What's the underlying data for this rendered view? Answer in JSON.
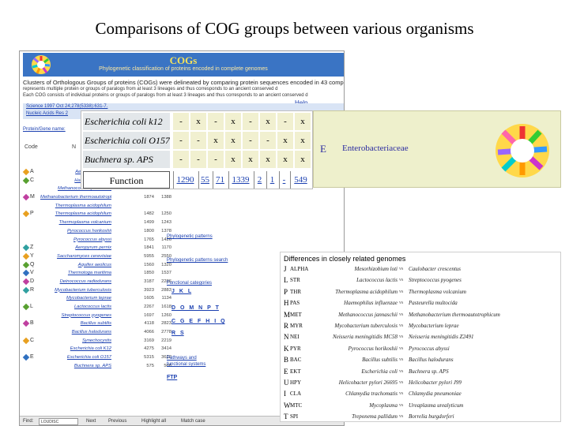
{
  "slide": {
    "title": "Comparisons of COG groups between various organisms"
  },
  "cog_page": {
    "banner_title": "COGs",
    "banner_subtitle": "Phylogenetic classification of proteins encoded in complete genomes",
    "intro_line1": "Clusters of Orthologous Groups of proteins (COGs) were delineated by comparing protein sequences encoded in 43 complete genom",
    "intro_line2": "represents multiple protein or groups of paralogs from at least 3 lineages and thus corresponds to an ancient conserved d",
    "intro_line3": "Each COG consists of individual proteins or groups of paralogs from at least 3 lineages and thus corresponds to an ancient conserved d",
    "help": "Help",
    "ref1": "Science 1997 Oct 24;278(5338):631-7.",
    "ref2": "Nucleic Acids Res 2",
    "protein_label": "Protein/Gene name:",
    "code_header": "Code",
    "code_header2": "N",
    "links": {
      "phylo_patterns": "Phylogenetic patterns",
      "phylo_search": "Phylogenetic patterns search",
      "func_categories": "Functional categories",
      "pathways": "Pathways and",
      "functional_systems": "functional systems",
      "ftp": "FTP"
    },
    "fcat_rows": [
      "J K L",
      "D O M N P T",
      "C G E F H I Q",
      "R S"
    ],
    "find_bar": {
      "label": "Find:",
      "value": "LOUDISC",
      "next": "Next",
      "previous": "Previous",
      "highlight": "Highlight all",
      "match_case": "Match case",
      "status": "Done"
    },
    "organisms": [
      {
        "code": "A",
        "name": "Aeropyrum pernix",
        "n1": "",
        "n2": ""
      },
      {
        "code": "C",
        "name": "Halobacterium sp.",
        "n1": "",
        "n2": ""
      },
      {
        "code": "",
        "name": "Methanococcus jannaschii",
        "n1": "",
        "n2": ""
      },
      {
        "code": "M",
        "name": "Methanobacterium thermoautotrophicum",
        "n1": "1874",
        "n2": "1388"
      },
      {
        "code": "",
        "name": "Thermoplasma acidophilum",
        "n1": "",
        "n2": ""
      },
      {
        "code": "P",
        "name": "Thermoplasma acidophilum",
        "n1": "1482",
        "n2": "1250"
      },
      {
        "code": "",
        "name": "Thermoplasma volcanium",
        "n1": "1499",
        "n2": "1243"
      },
      {
        "code": "",
        "name": "Pyrococcus horikoshii",
        "n1": "1800",
        "n2": "1378"
      },
      {
        "code": "",
        "name": "Pyrococcus abyssi",
        "n1": "1765",
        "n2": "1426"
      },
      {
        "code": "Z",
        "name": "Aeropyrum pernix",
        "n1": "1841",
        "n2": "1170"
      },
      {
        "code": "Y",
        "name": "Saccharomyces cerevisiae",
        "n1": "5955",
        "n2": "2550"
      },
      {
        "code": "Q",
        "name": "Aquifex aeolicus",
        "n1": "1560",
        "n2": "1320"
      },
      {
        "code": "V",
        "name": "Thermotoga maritima",
        "n1": "1850",
        "n2": "1537"
      },
      {
        "code": "D",
        "name": "Deinococcus radiodurans",
        "n1": "3187",
        "n2": "2286"
      },
      {
        "code": "R",
        "name": "Mycobacterium tuberculosis",
        "n1": "3923",
        "n2": "2883"
      },
      {
        "code": "",
        "name": "Mycobacterium leprae",
        "n1": "1605",
        "n2": "1134"
      },
      {
        "code": "L",
        "name": "Lactococcus lactis",
        "n1": "2267",
        "n2": "1618"
      },
      {
        "code": "",
        "name": "Streptococcus pyogenes",
        "n1": "1697",
        "n2": "1260"
      },
      {
        "code": "B",
        "name": "Bacillus subtilis",
        "n1": "4118",
        "n2": "2823"
      },
      {
        "code": "",
        "name": "Bacillus halodurans",
        "n1": "4066",
        "n2": "2778"
      },
      {
        "code": "C",
        "name": "Synechocystis",
        "n1": "3169",
        "n2": "2219"
      },
      {
        "code": "",
        "name": "Escherichia coli K12",
        "n1": "4275",
        "n2": "3414"
      },
      {
        "code": "E",
        "name": "Escherichia coli O157",
        "n1": "5315",
        "n2": "3622"
      },
      {
        "code": "",
        "name": "Buchnera sp. APS",
        "n1": "575",
        "n2": "568"
      }
    ]
  },
  "pattern": {
    "rows": [
      {
        "organism": "Escherichia coli k12",
        "marks": [
          "-",
          "x",
          "-",
          "x",
          "-",
          "x",
          "-",
          "x"
        ]
      },
      {
        "organism": "Escherichia coli O157",
        "marks": [
          "-",
          "-",
          "x",
          "x",
          "-",
          "-",
          "x",
          "x"
        ]
      },
      {
        "organism": "Buchnera sp. APS",
        "marks": [
          "-",
          "-",
          "-",
          "x",
          "x",
          "x",
          "x",
          "x"
        ]
      }
    ],
    "function_label": "Function",
    "function_counts": [
      "1290",
      "55",
      "71",
      "1339",
      "2",
      "1",
      "-",
      "549"
    ]
  },
  "entero": {
    "code": "E",
    "name": "Enterobacteriaceae"
  },
  "differences": {
    "heading": "Differences in closely related genomes",
    "rows": [
      {
        "code": "J",
        "short": "ALPHA",
        "org1": "Mesorhizobium loti",
        "vs": "vs",
        "org2": "Caulobacter crescentus"
      },
      {
        "code": "L",
        "short": "STR",
        "org1": "Lactococcus lactis",
        "vs": "vs",
        "org2": "Streptococcus pyogenes"
      },
      {
        "code": "P",
        "short": "THR",
        "org1": "Thermoplasma acidophilum",
        "vs": "vs",
        "org2": "Thermoplasma volcanium"
      },
      {
        "code": "H",
        "short": "PAS",
        "org1": "Haemophilus influenzae",
        "vs": "vs",
        "org2": "Pasteurella multocida"
      },
      {
        "code": "M",
        "short": "MET",
        "org1": "Methanococcus jannaschii",
        "vs": "vs",
        "org2": "Methanobacterium thermoautotrophicum"
      },
      {
        "code": "R",
        "short": "MYR",
        "org1": "Mycobacterium tuberculosis",
        "vs": "vs",
        "org2": "Mycobacterium leprae"
      },
      {
        "code": "N",
        "short": "NEI",
        "org1": "Neisseria meningitidis MC58",
        "vs": "vs",
        "org2": "Neisseria meningitidis Z2491"
      },
      {
        "code": "K",
        "short": "PYR",
        "org1": "Pyrococcus horikoshii",
        "vs": "vs",
        "org2": "Pyrococcus abyssi"
      },
      {
        "code": "B",
        "short": "BAC",
        "org1": "Bacillus subtilis",
        "vs": "vs",
        "org2": "Bacillus halodurans"
      },
      {
        "code": "E",
        "short": "EKT",
        "org1": "Escherichia coli",
        "vs": "vs",
        "org2": "Buchnera sp. APS"
      },
      {
        "code": "U",
        "short": "HPY",
        "org1": "Helicobacter pylori 26695",
        "vs": "vs",
        "org2": "Helicobacter pylori J99"
      },
      {
        "code": "I",
        "short": "CLA",
        "org1": "Chlamydia trachomatis",
        "vs": "vs",
        "org2": "Chlamydia pneumoniae"
      },
      {
        "code": "W",
        "short": "MTC",
        "org1": "Mycoplasma",
        "vs": "vs",
        "org2": "Ureaplasma urealyticum"
      },
      {
        "code": "T",
        "short": "SPI",
        "org1": "Treponema pallidum",
        "vs": "vs",
        "org2": "Borrelia burgdorferi"
      }
    ]
  },
  "colors": {
    "banner": "#3a74c4",
    "banner_title": "#f5e25a",
    "link": "#1a3fb0",
    "entero_bg": "#eef0cc",
    "pattern_cell": "#f1f0d0",
    "org_cell": "#e3e7ea"
  }
}
